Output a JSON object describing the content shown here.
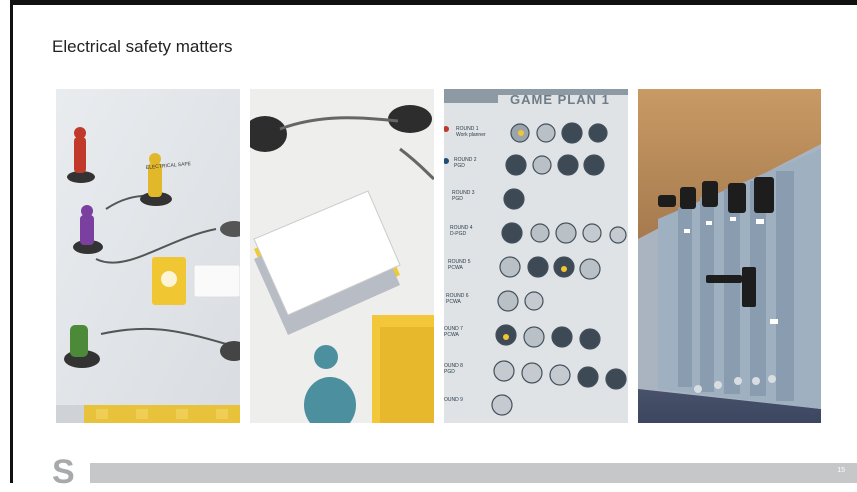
{
  "slide": {
    "title": "Electrical safety matters",
    "page_number": "15",
    "logo_letter": "S"
  },
  "photos": [
    {
      "name": "board-game-figures",
      "text": "ELECTRICAL SAFE"
    },
    {
      "name": "question-cards"
    },
    {
      "name": "game-plan-sheet",
      "heading": "GAME PLAN 1",
      "rounds": [
        {
          "label": "ROUND 1",
          "sub": "Work planner"
        },
        {
          "label": "ROUND 2",
          "sub": "PGD"
        },
        {
          "label": "ROUND 3",
          "sub": "PGD"
        },
        {
          "label": "ROUND 4",
          "sub": "D-PGD"
        },
        {
          "label": "ROUND 5",
          "sub": "PCWA"
        },
        {
          "label": "ROUND 6",
          "sub": "PCWA"
        },
        {
          "label": "OUND 7",
          "sub": "PCWA"
        },
        {
          "label": "OUND 8",
          "sub": "PGD"
        },
        {
          "label": "OUND 9",
          "sub": ""
        }
      ]
    },
    {
      "name": "switchgear-model"
    }
  ],
  "colors": {
    "accent_yellow": "#f2c230",
    "footer_gray": "#c6c7c9",
    "logo_gray": "#a7a9ac"
  }
}
